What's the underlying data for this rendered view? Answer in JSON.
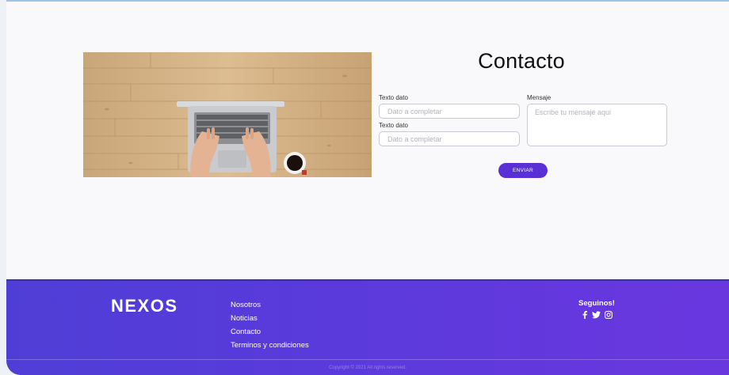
{
  "contact": {
    "title": "Contacto",
    "field1_label": "Texto dato",
    "field1_placeholder": "Dato a completar",
    "field2_label": "Texto dato",
    "field2_placeholder": "Dato a completar",
    "message_label": "Mensaje",
    "message_placeholder": "Escribe tu mensaje aqui",
    "submit_label": "ENVIAR"
  },
  "footer": {
    "logo": "NEXOS",
    "nav": [
      "Nosotros",
      "Noticias",
      "Contacto",
      "Terminos y condiciones"
    ],
    "social_title": "Seguinos!",
    "social_icons": [
      "facebook-icon",
      "twitter-icon",
      "instagram-icon"
    ],
    "copyright": "Copyright © 2021 All rights reserved."
  },
  "colors": {
    "accent": "#5a2fd6",
    "footer_start": "#4f3ed6",
    "footer_end": "#6a37df"
  }
}
